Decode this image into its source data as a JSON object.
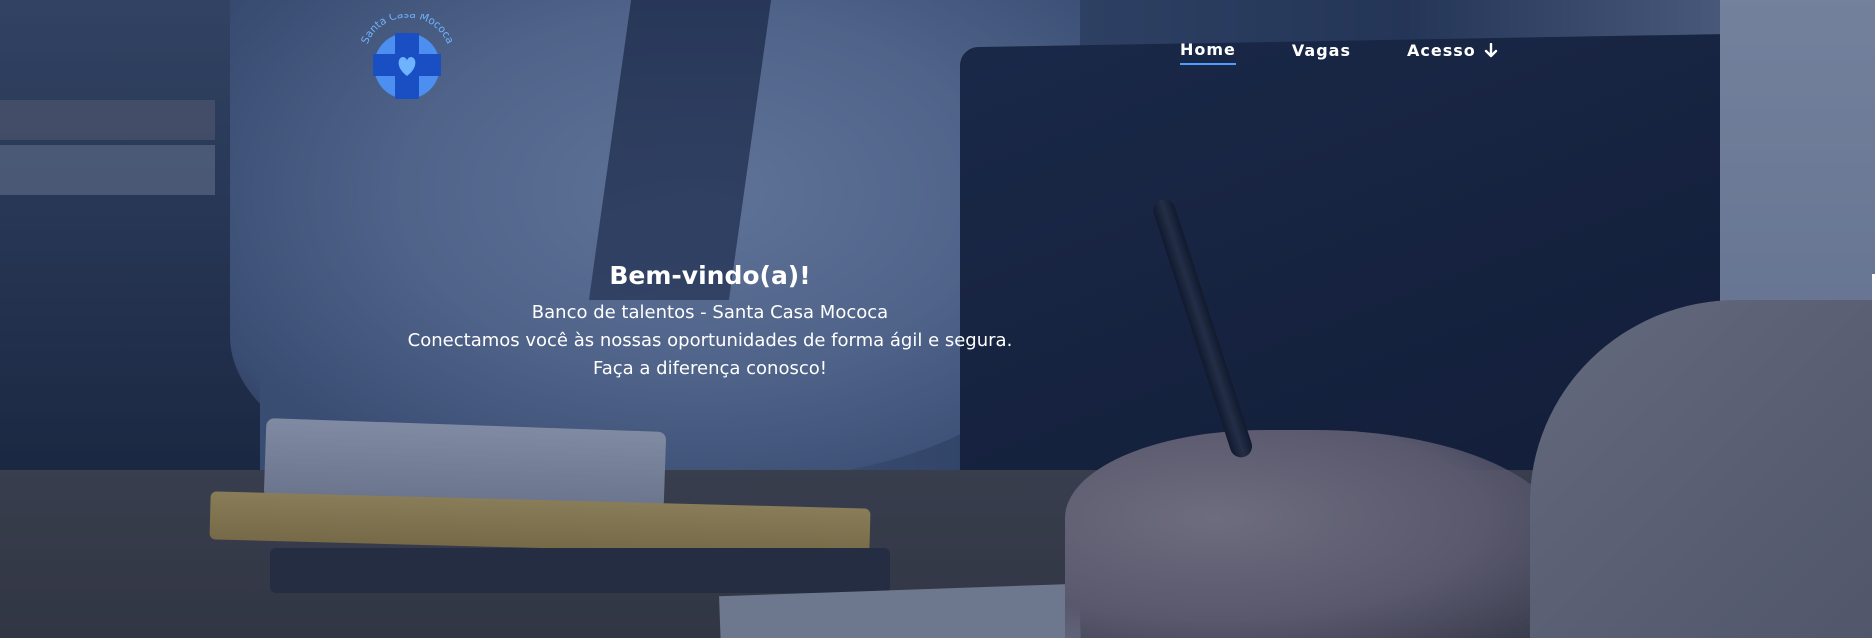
{
  "logo": {
    "text": "Santa Casa Mococa",
    "icon": "cross-heart-icon",
    "colors": {
      "circle": "#4c8ff0",
      "cross": "#1a4fc4",
      "heart": "#6fb3ff"
    }
  },
  "nav": {
    "items": [
      {
        "label": "Home",
        "active": true
      },
      {
        "label": "Vagas",
        "active": false
      },
      {
        "label": "Acesso",
        "active": false,
        "icon": "arrow-down-icon"
      }
    ],
    "active_underline_color": "#4d9dff"
  },
  "hero": {
    "title": "Bem-vindo(a)!",
    "lines": [
      "Banco de talentos - Santa Casa Mococa",
      "Conectamos você às nossas oportunidades de forma ágil e segura.",
      "Faça a diferença conosco!"
    ]
  }
}
